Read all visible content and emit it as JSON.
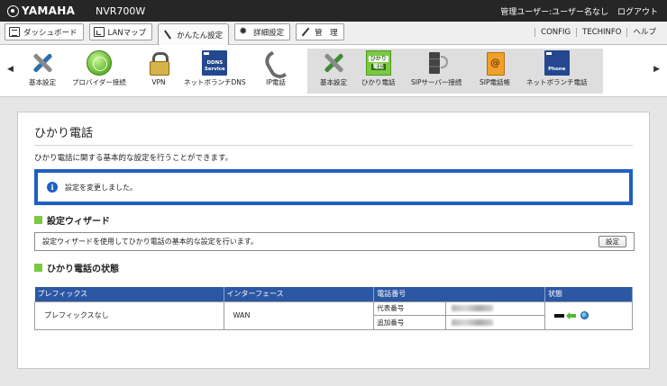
{
  "header": {
    "brand": "YAMAHA",
    "model": "NVR700W",
    "user_label": "管理ユーザー:ユーザー名なし",
    "logout_label": "ログアウト"
  },
  "tabs": [
    {
      "label": "ダッシュボード",
      "icon": "dashboard-icon"
    },
    {
      "label": "LANマップ",
      "icon": "lan-map-icon"
    },
    {
      "label": "かんたん設定",
      "icon": "wand-icon",
      "active": true
    },
    {
      "label": "詳細設定",
      "icon": "gear-icon"
    },
    {
      "label": "管　理",
      "icon": "wrench-icon"
    }
  ],
  "tab_links": {
    "config": "CONFIG",
    "techinfo": "TECHINFO",
    "help": "ヘルプ"
  },
  "icon_nav": {
    "main_items": [
      "基本設定",
      "プロバイダー接続",
      "VPN",
      "ネットボランチDNS",
      "IP電話"
    ],
    "sub_items": [
      "基本設定",
      "ひかり電話",
      "SIPサーバー接続",
      "SIP電話帳",
      "ネットボランチ電話"
    ],
    "selected": "ひかり電話",
    "ddns_badge": [
      "DDNS",
      "Service"
    ],
    "phone_badge": "Phone",
    "hikari_badge": [
      "ひかり",
      "電話"
    ]
  },
  "page": {
    "title": "ひかり電話",
    "description": "ひかり電話に関する基本的な設定を行うことができます。",
    "notice": "設定を変更しました。",
    "wizard_heading": "設定ウィザード",
    "wizard_text": "設定ウィザードを使用してひかり電話の基本的な設定を行います。",
    "wizard_button": "設定",
    "status_heading": "ひかり電話の状態"
  },
  "status_table": {
    "columns": [
      "プレフィックス",
      "インターフェース",
      "電話番号",
      "状態"
    ],
    "rows": [
      {
        "prefix": "プレフィックスなし",
        "interface": "WAN",
        "numbers": [
          {
            "label": "代表番号"
          },
          {
            "label": "追加番号"
          }
        ]
      }
    ]
  },
  "colors": {
    "accent_blue": "#1f5fc3",
    "table_header": "#2c57a3",
    "section_green": "#7ac943"
  }
}
